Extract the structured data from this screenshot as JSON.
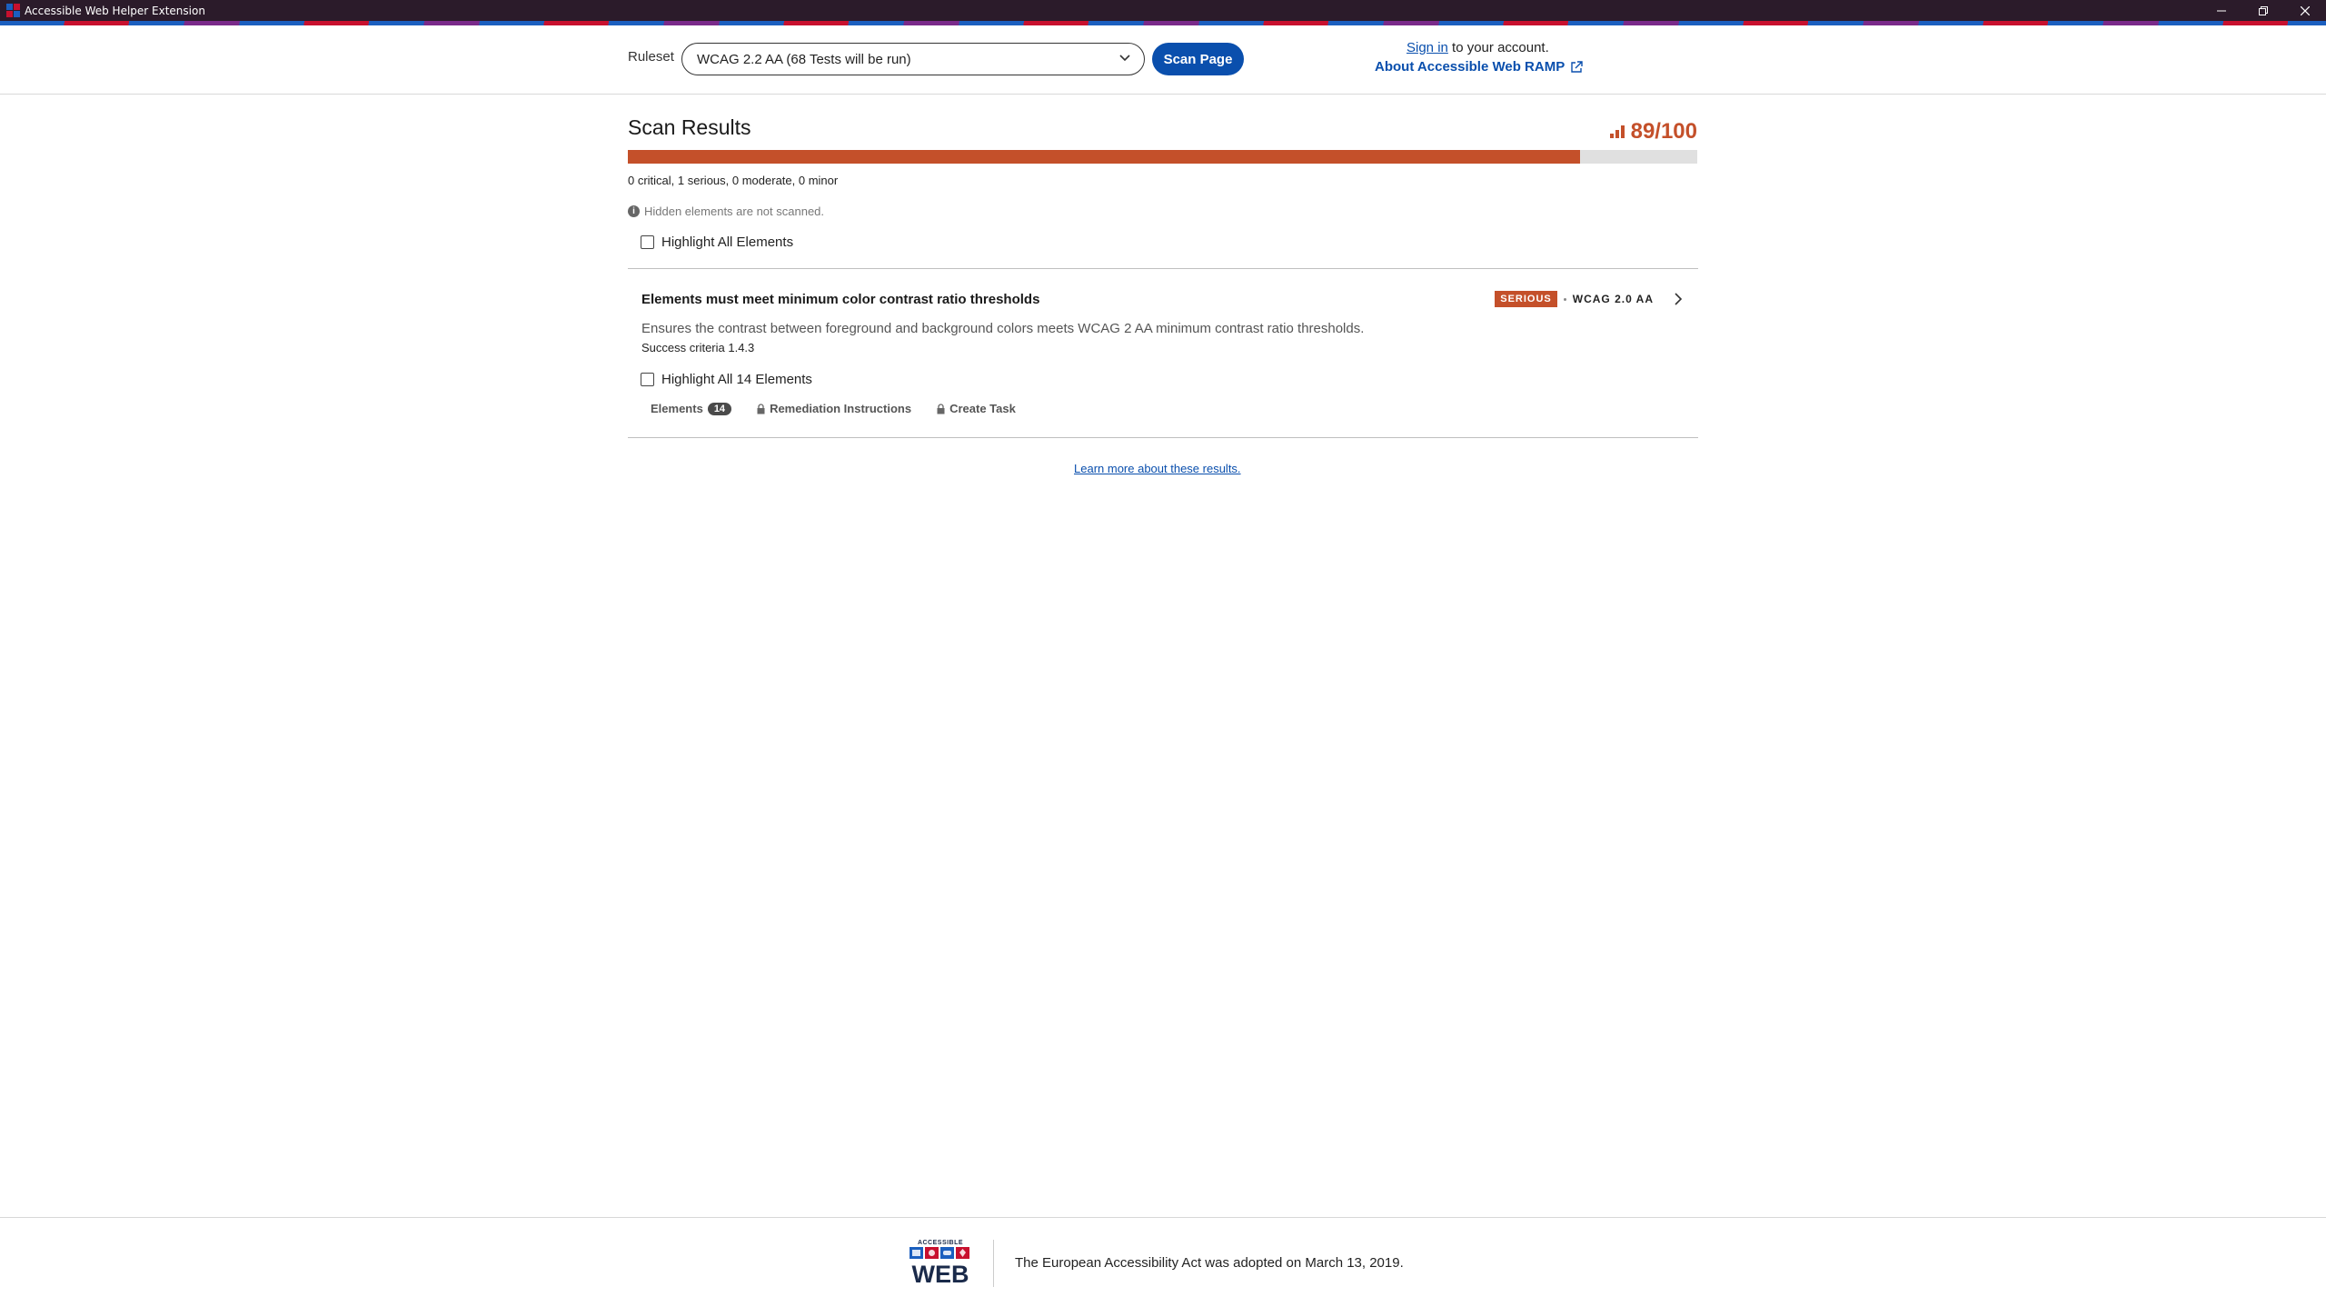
{
  "window": {
    "title": "Accessible Web Helper Extension",
    "controls": [
      "minimize",
      "restore",
      "close"
    ]
  },
  "header": {
    "ruleset_label": "Ruleset",
    "ruleset_value": "WCAG 2.2 AA (68 Tests will be run)",
    "scan_button": "Scan Page",
    "sign_in_link": "Sign in",
    "sign_in_suffix": " to your account.",
    "about_link": "About Accessible Web RAMP"
  },
  "results": {
    "title": "Scan Results",
    "score_text": "89/100",
    "score_fraction": 0.89,
    "counts": "0 critical, 1 serious, 0 moderate, 0 minor",
    "hidden_note": "Hidden elements are not scanned.",
    "highlight_all": "Highlight All Elements",
    "learn_more": "Learn more about these results."
  },
  "issue": {
    "title": "Elements must meet minimum color contrast ratio thresholds",
    "severity": "SERIOUS",
    "standard": "WCAG 2.0 AA",
    "description": "Ensures the contrast between foreground and background colors meets WCAG 2 AA minimum contrast ratio thresholds.",
    "criteria": "Success criteria 1.4.3",
    "highlight_label": "Highlight All 14 Elements",
    "tabs": {
      "elements_label": "Elements",
      "elements_count": "14",
      "remediation": "Remediation Instructions",
      "create_task": "Create Task"
    }
  },
  "footer": {
    "logo_small_text": "ACCESSIBLE",
    "logo_big_text": "WEB",
    "message": "The European Accessibility Act was adopted on March 13, 2019."
  },
  "colors": {
    "accent_blue": "#0a4fad",
    "serious_orange": "#c4502a",
    "titlebar": "#2b1b2a"
  }
}
